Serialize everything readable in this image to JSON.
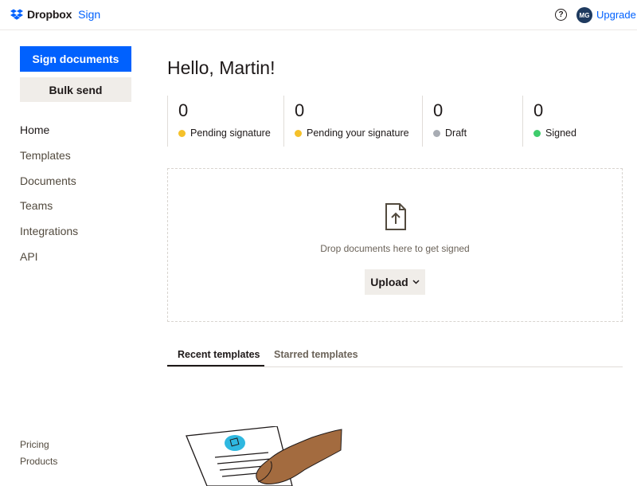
{
  "header": {
    "brand": "Dropbox",
    "product": "Sign",
    "help_icon": "question-circle-icon",
    "avatar_initials": "MG",
    "upgrade_label": "Upgrade",
    "brand_color": "#0061fe"
  },
  "sidebar": {
    "primary_button": "Sign documents",
    "secondary_button": "Bulk send",
    "items": [
      {
        "label": "Home"
      },
      {
        "label": "Templates"
      },
      {
        "label": "Documents"
      },
      {
        "label": "Teams"
      },
      {
        "label": "Integrations"
      },
      {
        "label": "API"
      }
    ],
    "footer": [
      {
        "label": "Pricing"
      },
      {
        "label": "Products"
      }
    ]
  },
  "main": {
    "greeting": "Hello, Martin!",
    "stats": [
      {
        "count": "0",
        "label": "Pending signature",
        "color": "#f5c12a"
      },
      {
        "count": "0",
        "label": "Pending your signature",
        "color": "#f5c12a"
      },
      {
        "count": "0",
        "label": "Draft",
        "color": "#a8acb3"
      },
      {
        "count": "0",
        "label": "Signed",
        "color": "#3fcc6c"
      }
    ],
    "dropzone": {
      "icon": "document-upload-icon",
      "text": "Drop documents here to get signed",
      "upload_label": "Upload"
    },
    "tabs": [
      {
        "label": "Recent templates"
      },
      {
        "label": "Starred templates"
      }
    ]
  }
}
